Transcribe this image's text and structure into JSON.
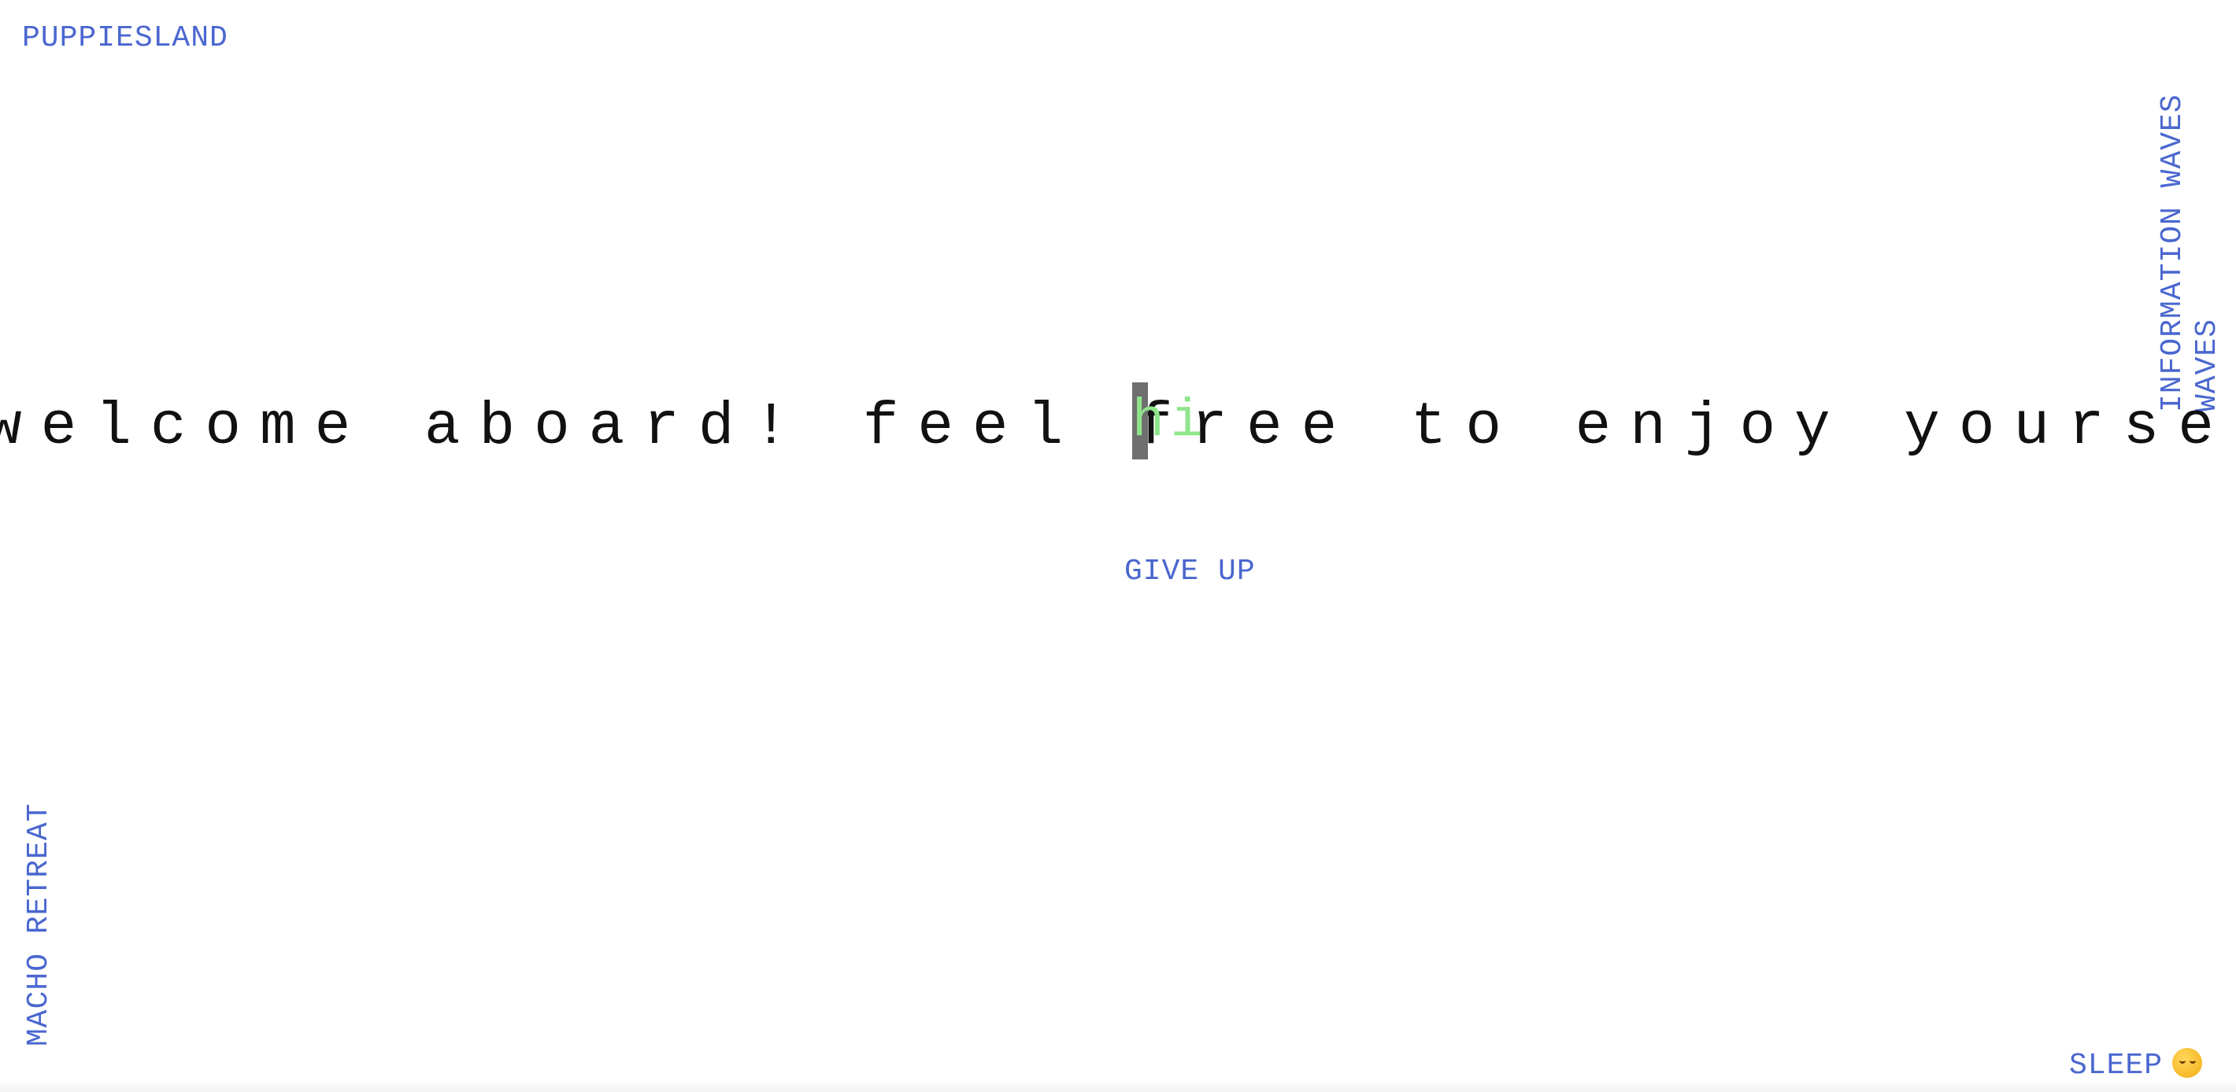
{
  "nav": {
    "top_left": "PUPPIESLAND",
    "bottom_left": "MACHO RETREAT",
    "right_line1": "INFORMATION WAVES",
    "right_line2": "WAVES",
    "bottom_right": "SLEEP"
  },
  "main": {
    "message": "welcome aboard! feel free to enjoy yourself",
    "typed_input": "hi",
    "give_up_label": "GIVE UP"
  },
  "colors": {
    "link": "#4a67cf",
    "text": "#111111",
    "typed": "#8fe58b",
    "caret": "#6f6f6f"
  },
  "icons": {
    "sleep": "yawning-face-emoji"
  }
}
